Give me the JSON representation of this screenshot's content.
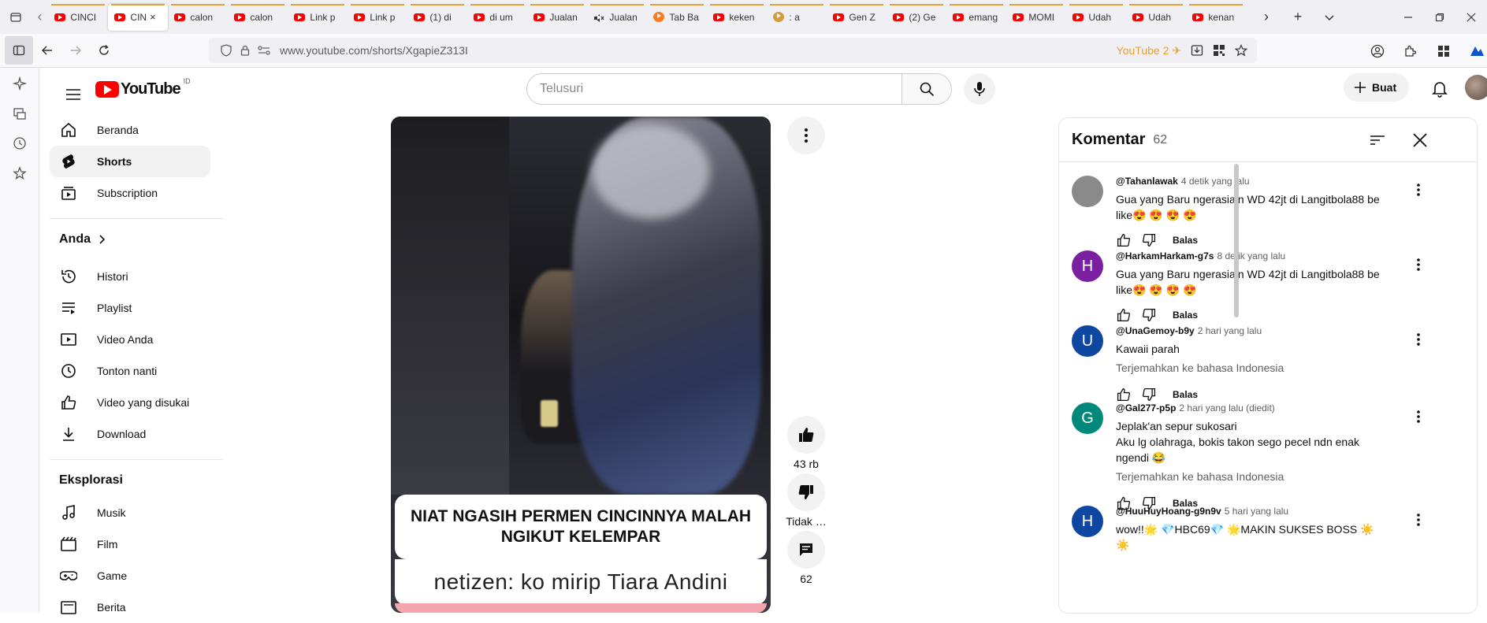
{
  "browser": {
    "tabs": [
      {
        "label": "CINCI",
        "icon": "youtube-icon"
      },
      {
        "label": "CIN",
        "icon": "youtube-icon",
        "active": true
      },
      {
        "label": "calon",
        "icon": "youtube-icon"
      },
      {
        "label": "calon",
        "icon": "youtube-icon"
      },
      {
        "label": "Link p",
        "icon": "youtube-icon"
      },
      {
        "label": "Link p",
        "icon": "youtube-icon"
      },
      {
        "label": "(1) di",
        "icon": "youtube-icon"
      },
      {
        "label": "di um",
        "icon": "youtube-icon"
      },
      {
        "label": "Jualan",
        "icon": "youtube-icon"
      },
      {
        "label": "Jualan",
        "icon": "muted-icon"
      },
      {
        "label": "Tab Ba",
        "icon": "firefox-icon"
      },
      {
        "label": "keken",
        "icon": "youtube-icon"
      },
      {
        "label": ": a",
        "icon": "emoji-icon"
      },
      {
        "label": "Gen Z",
        "icon": "youtube-icon"
      },
      {
        "label": "(2) Ge",
        "icon": "youtube-icon"
      },
      {
        "label": "emang",
        "icon": "youtube-icon"
      },
      {
        "label": "MOMI",
        "icon": "youtube-icon"
      },
      {
        "label": "Udah",
        "icon": "youtube-icon"
      },
      {
        "label": "Udah",
        "icon": "youtube-icon"
      },
      {
        "label": "kenan",
        "icon": "youtube-icon"
      }
    ],
    "active_tab_close": "×",
    "url": "www.youtube.com/shorts/XgapieZ313I",
    "yt_extension_badge": "YouTube 2"
  },
  "youtube": {
    "logo_text": "YouTube",
    "country_code": "ID",
    "search_placeholder": "Telusuri",
    "create_label": "Buat",
    "guide": {
      "main": [
        {
          "label": "Beranda",
          "icon": "home-icon"
        },
        {
          "label": "Shorts",
          "icon": "shorts-icon",
          "active": true
        },
        {
          "label": "Subscription",
          "icon": "subscriptions-icon"
        }
      ],
      "you_header": "Anda",
      "you": [
        {
          "label": "Histori",
          "icon": "history-icon"
        },
        {
          "label": "Playlist",
          "icon": "playlist-icon"
        },
        {
          "label": "Video Anda",
          "icon": "your-videos-icon"
        },
        {
          "label": "Tonton nanti",
          "icon": "watch-later-icon"
        },
        {
          "label": "Video yang disukai",
          "icon": "liked-icon"
        },
        {
          "label": "Download",
          "icon": "download-icon"
        }
      ],
      "explore_header": "Eksplorasi",
      "explore": [
        {
          "label": "Musik",
          "icon": "music-icon"
        },
        {
          "label": "Film",
          "icon": "film-icon"
        },
        {
          "label": "Game",
          "icon": "gaming-icon"
        },
        {
          "label": "Berita",
          "icon": "news-icon"
        }
      ]
    },
    "short": {
      "caption_top": "NIAT NGASIH PERMEN CINCINNYA MALAH NGIKUT KELEMPAR",
      "caption_bottom": "netizen: ko mirip Tiara Andini",
      "likes": "43 rb",
      "dislike_label": "Tidak …",
      "comments_count": "62"
    },
    "comments_panel": {
      "title": "Komentar",
      "count": "62",
      "translate_label": "Terjemahkan ke bahasa Indonesia",
      "reply_label": "Balas",
      "comments": [
        {
          "user": "@Tahanlawak",
          "time": "4 detik yang lalu",
          "text": "Gua yang Baru ngerasiain WD 42jt di Langitbola88 be like😍 😍 😍 😍",
          "avatar_letter": "",
          "avatar_color": "#8a8a8a"
        },
        {
          "user": "@HarkamHarkam-g7s",
          "time": "8 detik yang lalu",
          "text": "Gua yang Baru ngerasiain WD 42jt di Langitbola88 be like😍 😍 😍 😍",
          "avatar_letter": "H",
          "avatar_color": "#7b1fa2"
        },
        {
          "user": "@UnaGemoy-b9y",
          "time": "2 hari yang lalu",
          "text": "Kawaii parah",
          "avatar_letter": "U",
          "avatar_color": "#0d47a1"
        },
        {
          "user": "@Gal277-p5p",
          "time": "2 hari yang lalu (diedit)",
          "text": "Jeplak'an sepur sukosari\nAku lg olahraga, bokis takon sego pecel ndn enak\nngendi 😂",
          "avatar_letter": "G",
          "avatar_color": "#00897b"
        },
        {
          "user": "@HuuHuyHoang-g9n9v",
          "time": "5 hari yang lalu",
          "text": "wow!!🌟 💎HBC69💎 🌟MAKIN SUKSES BOSS ☀️ ☀️",
          "avatar_letter": "H",
          "avatar_color": "#0d47a1"
        }
      ]
    }
  }
}
